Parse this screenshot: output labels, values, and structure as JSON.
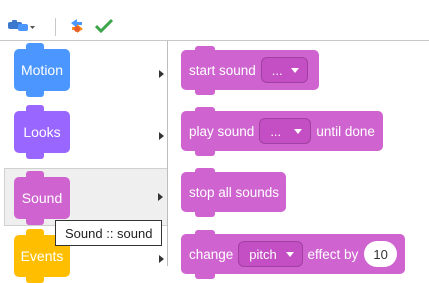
{
  "toolbar": {
    "blocks_menu_icon": "puzzle-blocks-icon",
    "swap_icon": "convert-icon",
    "check_icon": "check-icon"
  },
  "categories": [
    {
      "label": "Motion",
      "color": "#4c97ff",
      "selected": false
    },
    {
      "label": "Looks",
      "color": "#9966ff",
      "selected": false
    },
    {
      "label": "Sound",
      "color": "#cf63cf",
      "selected": true
    },
    {
      "label": "Events",
      "color": "#ffbf00",
      "selected": false
    }
  ],
  "blocks": {
    "start_sound": {
      "label": "start sound",
      "dropdown": "..."
    },
    "play_sound": {
      "label_before": "play sound",
      "dropdown": "...",
      "label_after": "until done"
    },
    "stop_all": {
      "label": "stop all sounds"
    },
    "change_effect": {
      "label_before": "change",
      "dropdown": "pitch",
      "label_after": "effect by",
      "value": "10"
    }
  },
  "colors": {
    "sound": "#cf63cf",
    "sound_dark": "#c94fc9"
  },
  "tooltip": {
    "text": "Sound :: sound"
  }
}
